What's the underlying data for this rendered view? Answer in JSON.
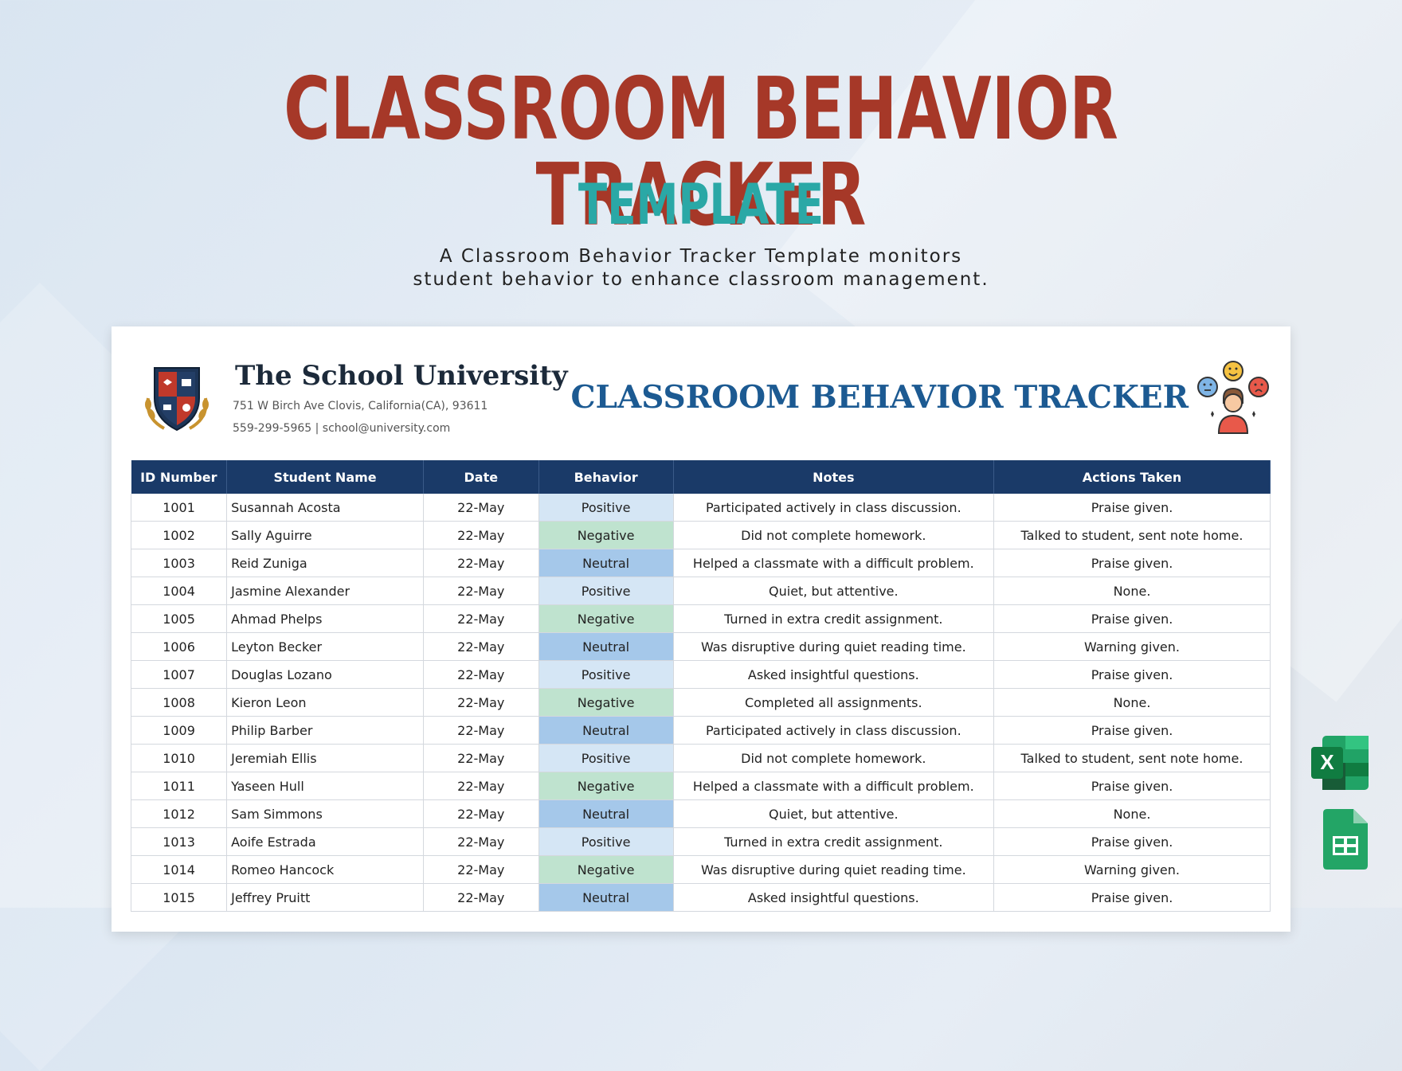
{
  "hero": {
    "title": "CLASSROOM BEHAVIOR TRACKER",
    "subtitle": "TEMPLATE",
    "description_line1": "A Classroom Behavior Tracker Template monitors",
    "description_line2": "student behavior to enhance classroom management."
  },
  "school": {
    "name": "The School University",
    "address": "751 W Birch Ave Clovis, California(CA), 93611",
    "contact": "559-299-5965 | school@university.com"
  },
  "document_title": "CLASSROOM BEHAVIOR TRACKER",
  "colors": {
    "title_red": "#a63828",
    "subtitle_teal": "#2aa8a6",
    "header_navy": "#1a3a68",
    "positive": "#d5e6f5",
    "negative": "#bfe3cf",
    "neutral": "#a5c8ea"
  },
  "table": {
    "headers": [
      "ID Number",
      "Student Name",
      "Date",
      "Behavior",
      "Notes",
      "Actions Taken"
    ],
    "rows": [
      {
        "id": "1001",
        "name": "Susannah Acosta",
        "date": "22-May",
        "behavior": "Positive",
        "notes": "Participated actively in class discussion.",
        "action": "Praise given."
      },
      {
        "id": "1002",
        "name": "Sally Aguirre",
        "date": "22-May",
        "behavior": "Negative",
        "notes": "Did not complete homework.",
        "action": "Talked to student, sent note home."
      },
      {
        "id": "1003",
        "name": "Reid Zuniga",
        "date": "22-May",
        "behavior": "Neutral",
        "notes": "Helped a classmate with a difficult problem.",
        "action": "Praise given."
      },
      {
        "id": "1004",
        "name": "Jasmine Alexander",
        "date": "22-May",
        "behavior": "Positive",
        "notes": "Quiet, but attentive.",
        "action": "None."
      },
      {
        "id": "1005",
        "name": "Ahmad Phelps",
        "date": "22-May",
        "behavior": "Negative",
        "notes": "Turned in extra credit assignment.",
        "action": "Praise given."
      },
      {
        "id": "1006",
        "name": "Leyton Becker",
        "date": "22-May",
        "behavior": "Neutral",
        "notes": "Was disruptive during quiet reading time.",
        "action": "Warning given."
      },
      {
        "id": "1007",
        "name": "Douglas Lozano",
        "date": "22-May",
        "behavior": "Positive",
        "notes": "Asked insightful questions.",
        "action": "Praise given."
      },
      {
        "id": "1008",
        "name": "Kieron Leon",
        "date": "22-May",
        "behavior": "Negative",
        "notes": "Completed all assignments.",
        "action": "None."
      },
      {
        "id": "1009",
        "name": "Philip Barber",
        "date": "22-May",
        "behavior": "Neutral",
        "notes": "Participated actively in class discussion.",
        "action": "Praise given."
      },
      {
        "id": "1010",
        "name": "Jeremiah Ellis",
        "date": "22-May",
        "behavior": "Positive",
        "notes": "Did not complete homework.",
        "action": "Talked to student, sent note home."
      },
      {
        "id": "1011",
        "name": "Yaseen Hull",
        "date": "22-May",
        "behavior": "Negative",
        "notes": "Helped a classmate with a difficult problem.",
        "action": "Praise given."
      },
      {
        "id": "1012",
        "name": "Sam Simmons",
        "date": "22-May",
        "behavior": "Neutral",
        "notes": "Quiet, but attentive.",
        "action": "None."
      },
      {
        "id": "1013",
        "name": "Aoife Estrada",
        "date": "22-May",
        "behavior": "Positive",
        "notes": "Turned in extra credit assignment.",
        "action": "Praise given."
      },
      {
        "id": "1014",
        "name": "Romeo Hancock",
        "date": "22-May",
        "behavior": "Negative",
        "notes": "Was disruptive during quiet reading time.",
        "action": "Warning given."
      },
      {
        "id": "1015",
        "name": "Jeffrey Pruitt",
        "date": "22-May",
        "behavior": "Neutral",
        "notes": "Asked insightful questions.",
        "action": "Praise given."
      }
    ]
  },
  "app_icons": {
    "excel_letter": "X"
  }
}
